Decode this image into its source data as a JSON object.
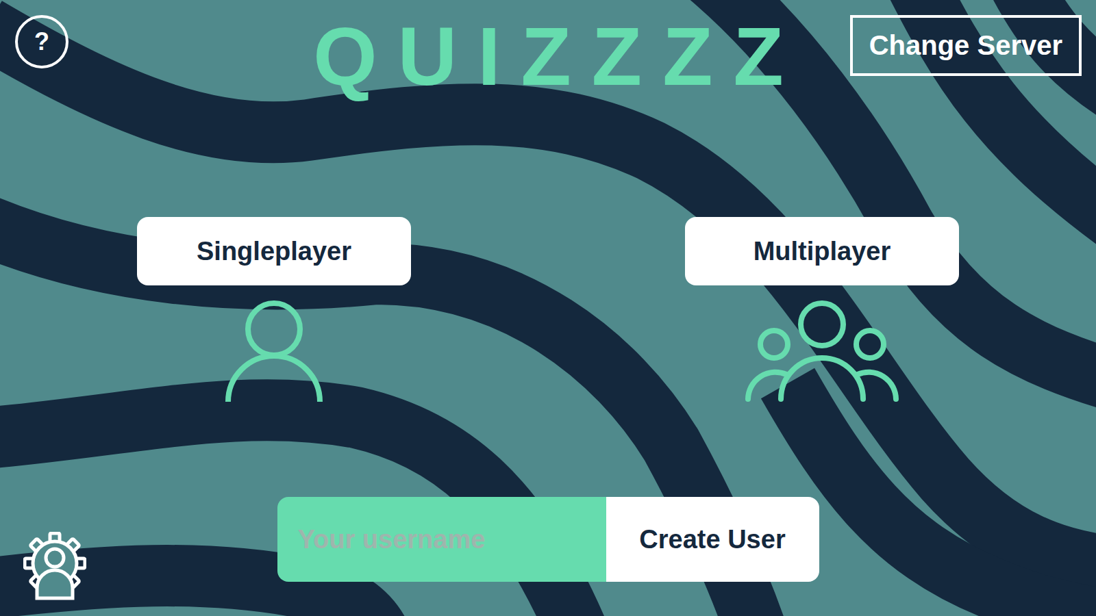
{
  "header": {
    "help": "?",
    "title": "QUIZZZZ",
    "change_server": "Change Server"
  },
  "modes": [
    {
      "label": "Singleplayer",
      "kind": "single"
    },
    {
      "label": "Multiplayer",
      "kind": "multi"
    }
  ],
  "user_form": {
    "placeholder": "Your username",
    "button": "Create User"
  }
}
